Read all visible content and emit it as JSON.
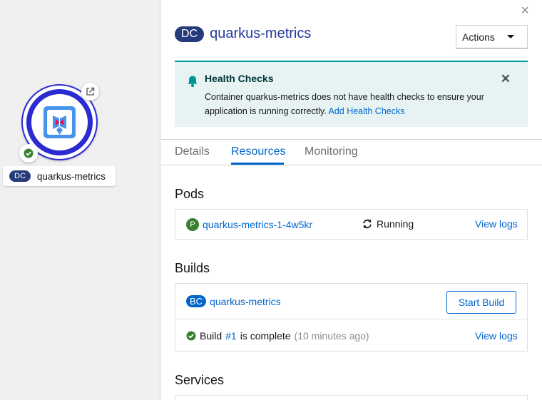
{
  "topology": {
    "node_badge": "DC",
    "node_name": "quarkus-metrics"
  },
  "panel": {
    "close_glyph": "×",
    "badge": "DC",
    "title": "quarkus-metrics",
    "actions_label": "Actions"
  },
  "alert": {
    "title": "Health Checks",
    "text": "Container quarkus-metrics does not have health checks to ensure your application is running correctly.",
    "link": "Add Health Checks"
  },
  "tabs": [
    "Details",
    "Resources",
    "Monitoring"
  ],
  "active_tab": "Resources",
  "pods": {
    "title": "Pods",
    "badge": "P",
    "name": "quarkus-metrics-1-4w5kr",
    "status": "Running",
    "logs_link": "View logs"
  },
  "builds": {
    "title": "Builds",
    "badge": "BC",
    "name": "quarkus-metrics",
    "start_button": "Start Build",
    "build_prefix": "Build",
    "build_number": "#1",
    "build_suffix": "is complete",
    "build_time": "(10 minutes ago)",
    "logs_link": "View logs"
  },
  "services": {
    "title": "Services"
  },
  "colors": {
    "accent": "#0066cc",
    "node_ring": "#2b2bd2",
    "success": "#38812f",
    "alert_bg": "#e6f3f2"
  }
}
